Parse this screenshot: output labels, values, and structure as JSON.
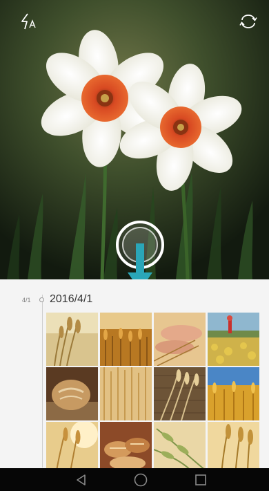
{
  "viewfinder": {
    "subject": "daffodil-flowers",
    "icons": {
      "flash": "flash-auto-icon",
      "switch_camera": "switch-camera-icon"
    },
    "accent_color": "#2aa6b8"
  },
  "gallery": {
    "short_date": "4/1",
    "full_date": "2016/4/1",
    "thumbnails": [
      "wheat-ears-closeup",
      "golden-wheat-field",
      "hands-holding-wheat",
      "field-with-red-tower",
      "round-bread-loaf",
      "wheat-field-closeup",
      "wheat-stalks-wood",
      "wheat-field-blue-sky",
      "wheat-ears-sunlight",
      "assorted-bread",
      "green-wheat-ears",
      "ripe-wheat-ears"
    ]
  },
  "navbar": {
    "back": "back-triangle-icon",
    "home": "home-circle-icon",
    "recent": "recent-apps-square-icon"
  }
}
